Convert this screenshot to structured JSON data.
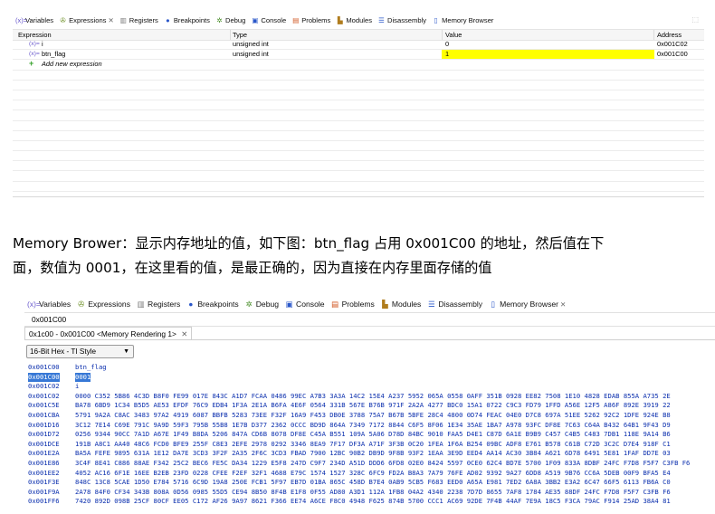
{
  "top_panel": {
    "tabs": [
      {
        "label": "Variables",
        "icon": "(x)="
      },
      {
        "label": "Expressions",
        "icon": "expressions-icon",
        "closable": true
      },
      {
        "label": "Registers",
        "icon": "registers-icon"
      },
      {
        "label": "Breakpoints",
        "icon": "breakpoints-icon"
      },
      {
        "label": "Debug",
        "icon": "debug-icon"
      },
      {
        "label": "Console",
        "icon": "console-icon"
      },
      {
        "label": "Problems",
        "icon": "problems-icon"
      },
      {
        "label": "Modules",
        "icon": "modules-icon"
      },
      {
        "label": "Disassembly",
        "icon": "disassembly-icon"
      },
      {
        "label": "Memory Browser",
        "icon": "memory-browser-icon"
      }
    ],
    "columns": {
      "expression": "Expression",
      "type": "Type",
      "value": "Value",
      "address": "Address"
    },
    "rows": [
      {
        "icon": "(x)=",
        "expression": "i",
        "type": "unsigned int",
        "value": "0",
        "address": "0x001C02"
      },
      {
        "icon": "(x)=",
        "expression": "btn_flag",
        "type": "unsigned int",
        "value": "1",
        "address": "0x001C00"
      },
      {
        "icon": "+",
        "expression": "Add new expression",
        "type": "",
        "value": "",
        "address": ""
      }
    ],
    "highlight_color": "#ffff00"
  },
  "paragraph": {
    "line1": "Memory Brower：显示内存地址的值，如下图：btn_flag 占用 0x001C00 的地址，然后值在下",
    "line2": "面，数值为 0001，在这里看的值，是最正确的，因为直接在内存里面存储的值"
  },
  "memory_panel": {
    "tabs": [
      {
        "label": "Variables",
        "icon": "(x)="
      },
      {
        "label": "Expressions",
        "icon": "expressions-icon"
      },
      {
        "label": "Registers",
        "icon": "registers-icon"
      },
      {
        "label": "Breakpoints",
        "icon": "breakpoints-icon"
      },
      {
        "label": "Debug",
        "icon": "debug-icon"
      },
      {
        "label": "Console",
        "icon": "console-icon"
      },
      {
        "label": "Problems",
        "icon": "problems-icon"
      },
      {
        "label": "Modules",
        "icon": "modules-icon"
      },
      {
        "label": "Disassembly",
        "icon": "disassembly-icon"
      },
      {
        "label": "Memory Browser",
        "icon": "memory-browser-icon",
        "closable": true
      }
    ],
    "address_input": "0x001C00",
    "rendering_tab": "0x1c00 - 0x001C00 <Memory Rendering 1>",
    "format": "16-Bit Hex - TI Style",
    "selection_color": "#3778d6",
    "rows": [
      {
        "addr": "0x001C00",
        "data": "btn_flag",
        "selected": false
      },
      {
        "addr": "0x001C00",
        "data": "0001",
        "selected": true
      },
      {
        "addr": "0x001C02",
        "data": "i",
        "selected": false
      },
      {
        "addr": "0x001C02",
        "data": "0000 C352 5B86 4C3D B8F0 FE99 017E 843C A1D7 FCAA 0486 99EC A7B3 3A3A 14C2 15E4 A237 5952 065A 0558 0AFF 351B 0928 EE82 7508 1E10 4828 EDAB 855A A735 2E"
      },
      {
        "addr": "0x001C5E",
        "data": "BA78 6BD9 1C34 B5D5 AE53 EFDF 76C9 EDB4 1F3A 2E1A B6FA 4E6F 0564 331B 567E B76B 971F 2A2A 4277 BDC0 15A1 0722 C9C3 FD79 1FFD A56E 12F5 A86F 892E 3919 22"
      },
      {
        "addr": "0x001CBA",
        "data": "5791 9A2A C8AC 3483 97A2 4919 6087 BBFB 5283 73EE F32F 16A9 F453 DB0E 3788 75A7 B67B 5BFE 28C4 4800 0D74 FEAC 04E0 D7C8 697A 51EE 5262 92C2 1DFE 924E B8"
      },
      {
        "addr": "0x001D16",
        "data": "3C12 7E14 C69E 791C 9A9D 59F3 795B 55B8 1E7B D377 2362 0CCC BD9D 864A 7349 7172 8844 C6F5 8F06 1E34 35AE 1BA7 A978 93FC DF8E 7C63 C64A B432 64B1 9F43 D9"
      },
      {
        "addr": "0x001D72",
        "data": "0256 9344 90CC 7A1D A67E 1F49 B8DA 5206 847A CD6B 8078 DF8E C45A B551 109A 5A06 D78D 84BC 9010 FAA5 D4E1 C87D 6A1E B9B9 C457 C4B5 C483 7DB1 118E 9A14 B6"
      },
      {
        "addr": "0x001DCE",
        "data": "191B A8C1 AA40 48C6 FCD0 BFE9 255F C8E3 2EFE 2978 0292 3346 8EA9 7F17 DF3A A71F 3F3B 0C20 1FEA 1F6A B254 09BC ADF8 E761 B578 C61B C72D 3C2C D7E4 918F C1"
      },
      {
        "addr": "0x001E2A",
        "data": "BA5A FEFE 9895 631A 1E12 DA7E 3CD3 3F2F 2A35 2F6C 3CD3 FBAD 7900 12BC 90B2 DB9D 9F8B 93F2 1EAA 3E9D EED4 AA14 AC30 3B84 A621 6D78 6491 5E81 1FAF DD7E 03"
      },
      {
        "addr": "0x001E86",
        "data": "3C4F 8E41 C886 88AE F342 25C2 BEC6 FE5C DA34 1229 E5F8 247D C9F7 234D A51D DDD6 6FD8 02E0 8424 5597 0CE0 62C4 BD7E 5700 1F09 833A 8DBF 24FC F7D8 F5F7 C3FB F6"
      },
      {
        "addr": "0x001EE2",
        "data": "4052 AC16 6F1E 16EE B2EB 23FD 0228 CFEE F2EF 32F1 4688 E79C 1574 1527 328C 6FC9 FD2A B8A3 7A79 76FE AD02 9392 9A27 6DD8 A519 9B76 CC6A 5DEB 00F9 BFA5 E4"
      },
      {
        "addr": "0x001F3E",
        "data": "848C 13C8 5CAE 1D50 E784 5716 6C9D 19A8 250E FCB1 5F97 EB7D 01BA 865C 458D B7E4 0AB9 5CB5 F683 EED0 A65A E981 7ED2 6A8A 3BB2 E3A2 6C47 66F5 6113 FB6A C0"
      },
      {
        "addr": "0x001F9A",
        "data": "2A78 84F0 CF34 343B 808A 0D56 0985 55D5 CE94 8B50 8F4B E1F8 0F55 AD80 A3D1 112A 1FB8 04A2 4340 2238 7D7D 8655 7AF8 1784 AE35 88DF 24FC F7D8 F5F7 C3FB F6"
      },
      {
        "addr": "0x001FF6",
        "data": "7420 892D 098B 25CF 80CF EE05 C172 AF26 9A97 8621 F366 EE74 A6CE F8C0 4948 F625 874B 5700 CCC1 AC69 92DE 7F4B 44AF 7E9A 18C5 F3CA 79AC F914 25AD 38A4 81"
      }
    ]
  }
}
